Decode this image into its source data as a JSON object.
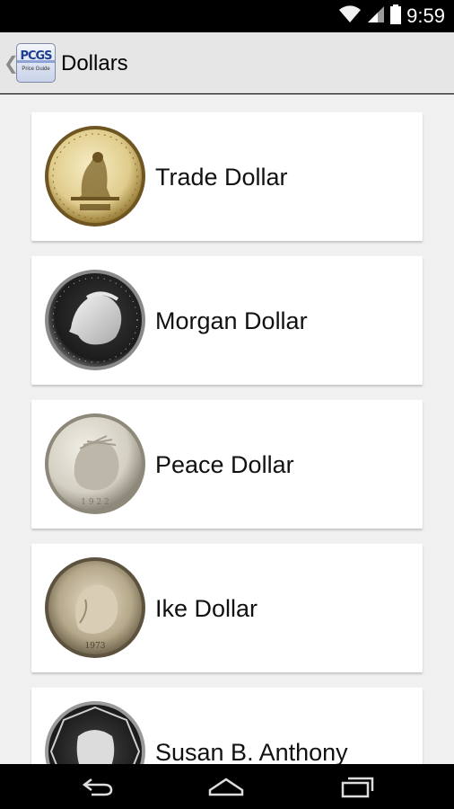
{
  "status_bar": {
    "time": "9:59",
    "icons": [
      "wifi-icon",
      "cell-signal-icon",
      "battery-icon"
    ]
  },
  "action_bar": {
    "title": "Dollars",
    "app_icon": {
      "name": "pcgs-app-icon",
      "logo_text": "PCGS",
      "subtitle": "Price Guide"
    },
    "up_icon": "chevron-left-icon"
  },
  "coins": [
    {
      "label": "Trade Dollar",
      "image": "trade-dollar-coin"
    },
    {
      "label": "Morgan Dollar",
      "image": "morgan-dollar-coin"
    },
    {
      "label": "Peace Dollar",
      "image": "peace-dollar-coin"
    },
    {
      "label": "Ike Dollar",
      "image": "ike-dollar-coin"
    },
    {
      "label": "Susan B. Anthony",
      "image": "susan-b-anthony-dollar-coin"
    }
  ],
  "nav_bar": {
    "buttons": [
      "back-icon",
      "home-icon",
      "recent-apps-icon"
    ]
  },
  "colors": {
    "action_bar_bg": "#e6e6e6",
    "content_bg": "#f0f0f0",
    "card_bg": "#ffffff",
    "system_bars": "#000000"
  }
}
